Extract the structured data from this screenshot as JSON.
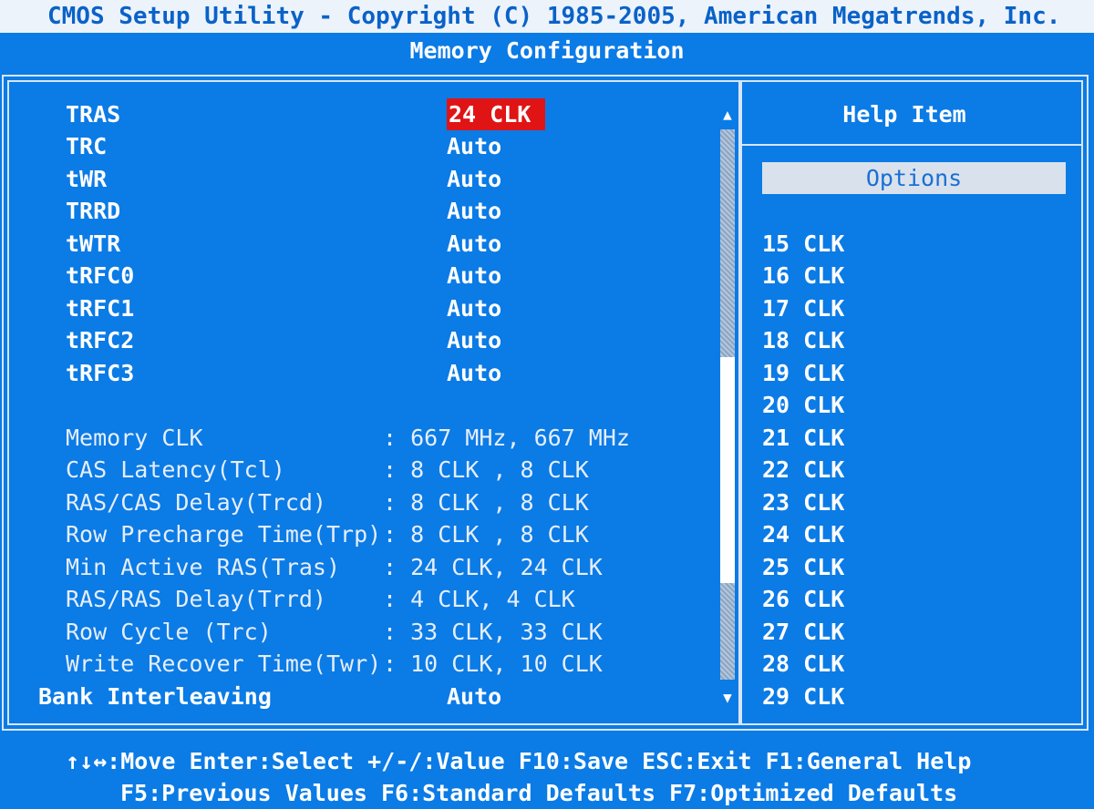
{
  "header": {
    "title": "CMOS Setup Utility - Copyright (C) 1985-2005, American Megatrends, Inc.",
    "subtitle": "Memory Configuration"
  },
  "settings": [
    {
      "label": "TRAS",
      "value": "24 CLK",
      "selected": true
    },
    {
      "label": "TRC",
      "value": "Auto"
    },
    {
      "label": "tWR",
      "value": "Auto"
    },
    {
      "label": "TRRD",
      "value": "Auto"
    },
    {
      "label": "tWTR",
      "value": "Auto"
    },
    {
      "label": "tRFC0",
      "value": "Auto"
    },
    {
      "label": "tRFC1",
      "value": "Auto"
    },
    {
      "label": "tRFC2",
      "value": "Auto"
    },
    {
      "label": "tRFC3",
      "value": "Auto"
    }
  ],
  "info": [
    {
      "label": "Memory CLK",
      "value": ": 667 MHz, 667 MHz"
    },
    {
      "label": "CAS Latency(Tcl)",
      "value": ": 8 CLK , 8 CLK"
    },
    {
      "label": "RAS/CAS Delay(Trcd)",
      "value": ": 8 CLK , 8 CLK"
    },
    {
      "label": "Row Precharge Time(Trp)",
      "value": ": 8 CLK , 8 CLK"
    },
    {
      "label": "Min Active RAS(Tras)",
      "value": ": 24 CLK, 24 CLK"
    },
    {
      "label": "RAS/RAS Delay(Trrd)",
      "value": ": 4 CLK, 4 CLK"
    },
    {
      "label": "Row Cycle (Trc)",
      "value": ": 33 CLK, 33 CLK"
    },
    {
      "label": "Write Recover Time(Twr)",
      "value": ": 10 CLK, 10 CLK"
    }
  ],
  "bank": {
    "label": "Bank Interleaving",
    "value": "Auto"
  },
  "help": {
    "title": "Help Item",
    "options_label": "Options",
    "options": [
      "15 CLK",
      "16 CLK",
      "17 CLK",
      "18 CLK",
      "19 CLK",
      "20 CLK",
      "21 CLK",
      "22 CLK",
      "23 CLK",
      "24 CLK",
      "25 CLK",
      "26 CLK",
      "27 CLK",
      "28 CLK",
      "29 CLK"
    ]
  },
  "scrollbar": {
    "up_icon": "▲",
    "down_icon": "▼"
  },
  "footer": {
    "line1": "↑↓↔:Move  Enter:Select  +/-/:Value  F10:Save  ESC:Exit  F1:General Help",
    "line2": "F5:Previous Values     F6:Standard Defaults     F7:Optimized Defaults"
  }
}
